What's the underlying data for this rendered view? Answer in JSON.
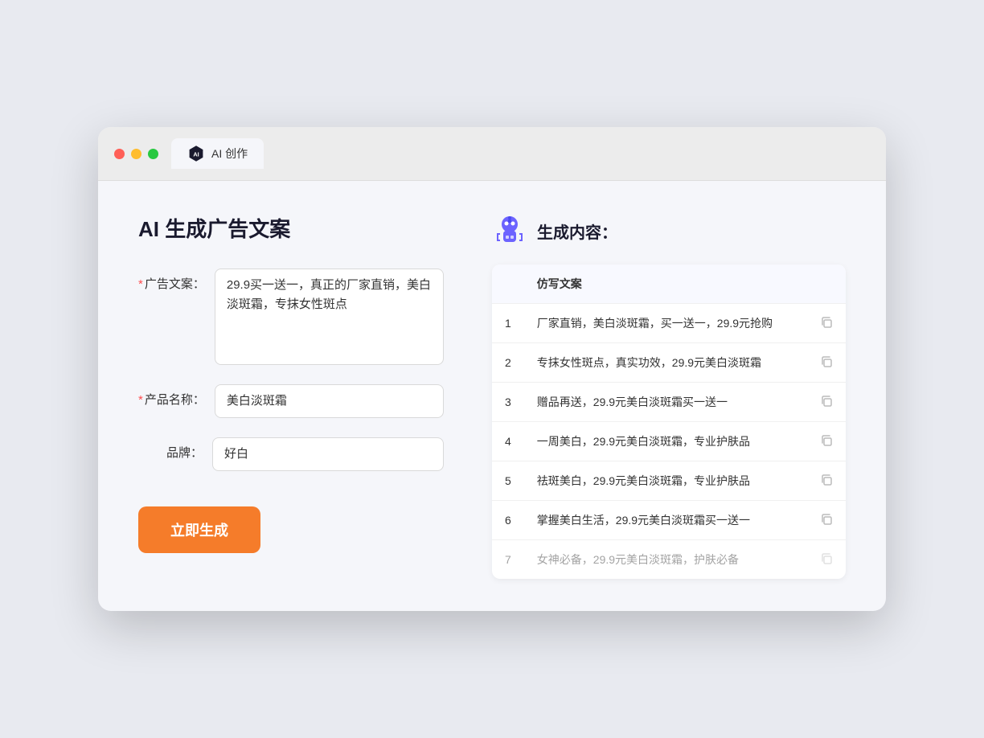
{
  "window": {
    "tab_label": "AI 创作",
    "traffic_lights": [
      "red",
      "yellow",
      "green"
    ]
  },
  "left": {
    "title": "AI 生成广告文案",
    "form": {
      "ad_copy_label": "广告文案：",
      "ad_copy_required": true,
      "ad_copy_value": "29.9买一送一，真正的厂家直销，美白淡斑霜，专抹女性斑点",
      "product_label": "产品名称：",
      "product_required": true,
      "product_value": "美白淡斑霜",
      "brand_label": "品牌：",
      "brand_required": false,
      "brand_value": "好白"
    },
    "generate_btn": "立即生成"
  },
  "right": {
    "header_title": "生成内容：",
    "table": {
      "column_header": "仿写文案",
      "rows": [
        {
          "num": 1,
          "text": "厂家直销，美白淡斑霜，买一送一，29.9元抢购"
        },
        {
          "num": 2,
          "text": "专抹女性斑点，真实功效，29.9元美白淡斑霜"
        },
        {
          "num": 3,
          "text": "赠品再送，29.9元美白淡斑霜买一送一"
        },
        {
          "num": 4,
          "text": "一周美白，29.9元美白淡斑霜，专业护肤品"
        },
        {
          "num": 5,
          "text": "祛斑美白，29.9元美白淡斑霜，专业护肤品"
        },
        {
          "num": 6,
          "text": "掌握美白生活，29.9元美白淡斑霜买一送一"
        },
        {
          "num": 7,
          "text": "女神必备，29.9元美白淡斑霜，护肤必备",
          "faded": true
        }
      ]
    }
  }
}
